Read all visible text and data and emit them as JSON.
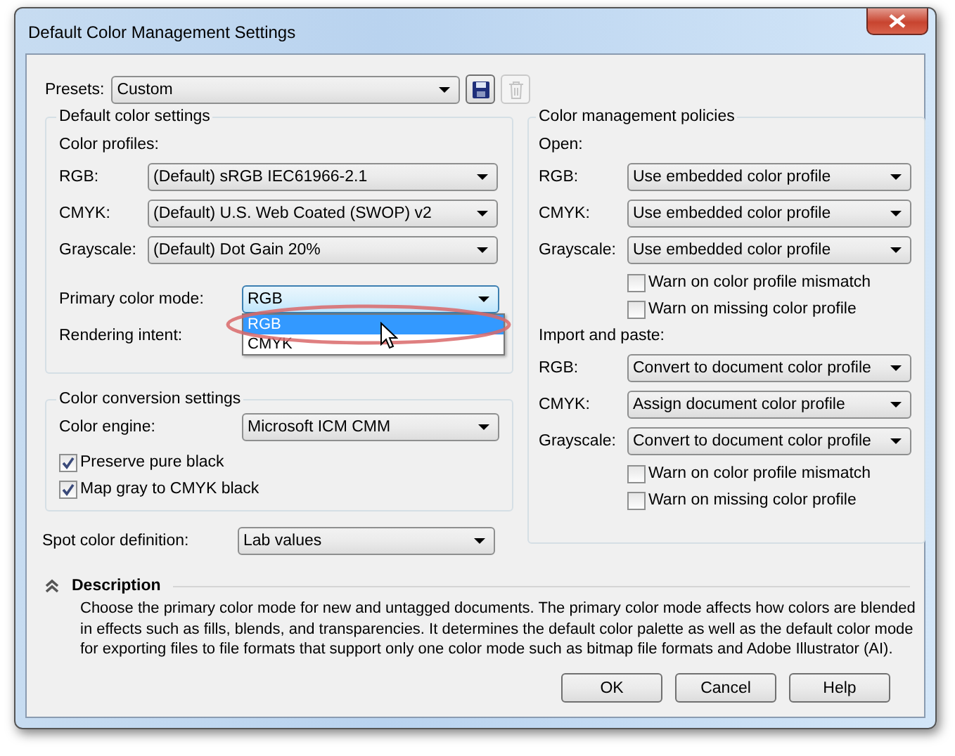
{
  "window": {
    "title": "Default Color Management Settings"
  },
  "presets": {
    "label": "Presets:",
    "value": "Custom"
  },
  "default_color_settings": {
    "title": "Default color settings",
    "profiles_label": "Color profiles:",
    "profiles": [
      {
        "label": "RGB:",
        "value": "(Default) sRGB IEC61966-2.1"
      },
      {
        "label": "CMYK:",
        "value": "(Default) U.S. Web Coated (SWOP) v2"
      },
      {
        "label": "Grayscale:",
        "value": "(Default) Dot Gain 20%"
      }
    ],
    "primary_mode": {
      "label": "Primary color mode:",
      "value": "RGB",
      "expanded": true,
      "options": [
        {
          "label": "RGB",
          "selected": true
        },
        {
          "label": "CMYK",
          "selected": false
        }
      ]
    },
    "rendering_intent": {
      "label": "Rendering intent:"
    }
  },
  "conversion": {
    "title": "Color conversion settings",
    "engine": {
      "label": "Color engine:",
      "value": "Microsoft ICM CMM"
    },
    "checks": [
      {
        "label": "Preserve pure black",
        "checked": true
      },
      {
        "label": "Map gray to CMYK black",
        "checked": true
      }
    ]
  },
  "spot": {
    "label": "Spot color definition:",
    "value": "Lab values"
  },
  "policies": {
    "title": "Color management policies",
    "sections": [
      {
        "title": "Open:",
        "rows": [
          {
            "label": "RGB:",
            "value": "Use embedded color profile"
          },
          {
            "label": "CMYK:",
            "value": "Use embedded color profile"
          },
          {
            "label": "Grayscale:",
            "value": "Use embedded color profile"
          }
        ],
        "checks": [
          {
            "label": "Warn on color profile mismatch",
            "checked": false
          },
          {
            "label": "Warn on missing color profile",
            "checked": false
          }
        ]
      },
      {
        "title": "Import and paste:",
        "rows": [
          {
            "label": "RGB:",
            "value": "Convert to document color profile"
          },
          {
            "label": "CMYK:",
            "value": "Assign document color profile"
          },
          {
            "label": "Grayscale:",
            "value": "Convert to document color profile"
          }
        ],
        "checks": [
          {
            "label": "Warn on color profile mismatch",
            "checked": false
          },
          {
            "label": "Warn on missing color profile",
            "checked": false
          }
        ]
      }
    ]
  },
  "description": {
    "title": "Description",
    "expanded": true,
    "text": "Choose the primary color mode for new and untagged documents. The primary color mode affects how colors are blended in effects such as fills, blends, and transparencies. It determines the default color palette as well as the default color mode for exporting files to file formats that support only one color mode such as bitmap file formats and Adobe Illustrator (AI)."
  },
  "buttons": [
    "OK",
    "Cancel",
    "Help"
  ]
}
